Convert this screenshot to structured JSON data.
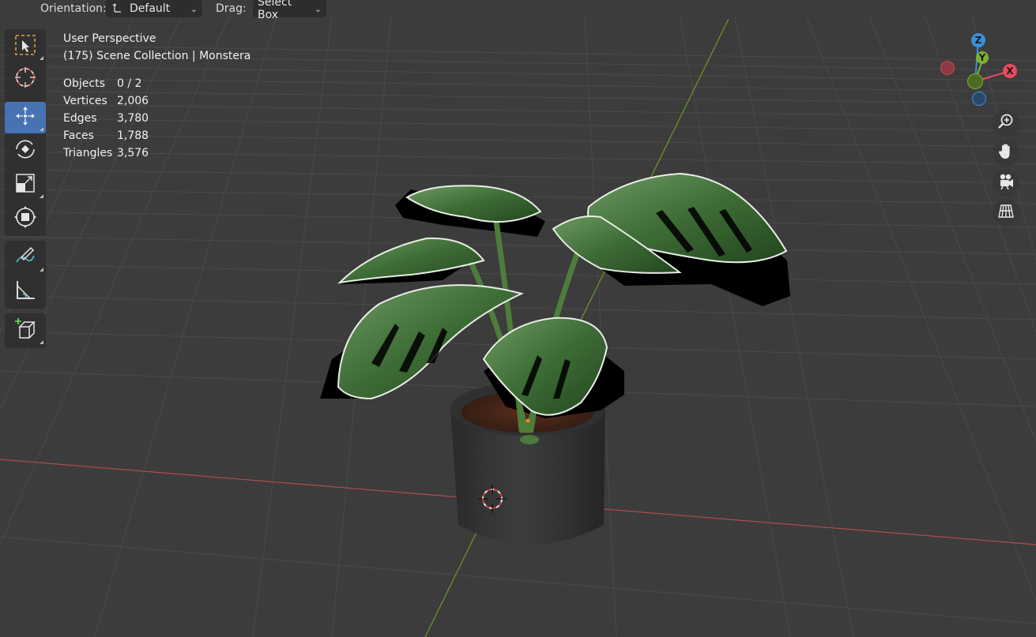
{
  "header": {
    "orientation_label": "Orientation:",
    "orientation_value": "Default",
    "drag_label": "Drag:",
    "drag_value": "Select Box"
  },
  "toolbar": {
    "tools": [
      {
        "name": "select-box",
        "icon": "select-box-icon",
        "active": false
      },
      {
        "name": "cursor",
        "icon": "cursor-icon",
        "active": false
      },
      {
        "name": "move",
        "icon": "move-icon",
        "active": true
      },
      {
        "name": "rotate",
        "icon": "rotate-icon",
        "active": false
      },
      {
        "name": "scale",
        "icon": "scale-icon",
        "active": false
      },
      {
        "name": "transform",
        "icon": "transform-icon",
        "active": false
      },
      {
        "name": "annotate",
        "icon": "annotate-icon",
        "active": false
      },
      {
        "name": "measure",
        "icon": "measure-icon",
        "active": false
      },
      {
        "name": "add-cube",
        "icon": "add-cube-icon",
        "active": false
      }
    ]
  },
  "viewport": {
    "view_name": "User Perspective",
    "collection_line": "(175) Scene Collection | Monstera",
    "stats": [
      {
        "label": "Objects",
        "value": "0 / 2"
      },
      {
        "label": "Vertices",
        "value": "2,006"
      },
      {
        "label": "Edges",
        "value": "3,780"
      },
      {
        "label": "Faces",
        "value": "1,788"
      },
      {
        "label": "Triangles",
        "value": "3,576"
      }
    ]
  },
  "gizmo": {
    "z_label": "Z",
    "y_label": "Y",
    "x_label": "X",
    "colors": {
      "x": "#e84a5f",
      "y": "#7bb32e",
      "z": "#3b8fd9"
    }
  },
  "nav_buttons": [
    {
      "icon": "zoom-icon"
    },
    {
      "icon": "hand-icon"
    },
    {
      "icon": "camera-icon"
    },
    {
      "icon": "grid-icon"
    }
  ],
  "colors": {
    "background": "#3c3c3c",
    "active_tool": "#4772b3",
    "x_axis_line": "#b54a4a",
    "y_axis_line": "#6a9a2a"
  }
}
